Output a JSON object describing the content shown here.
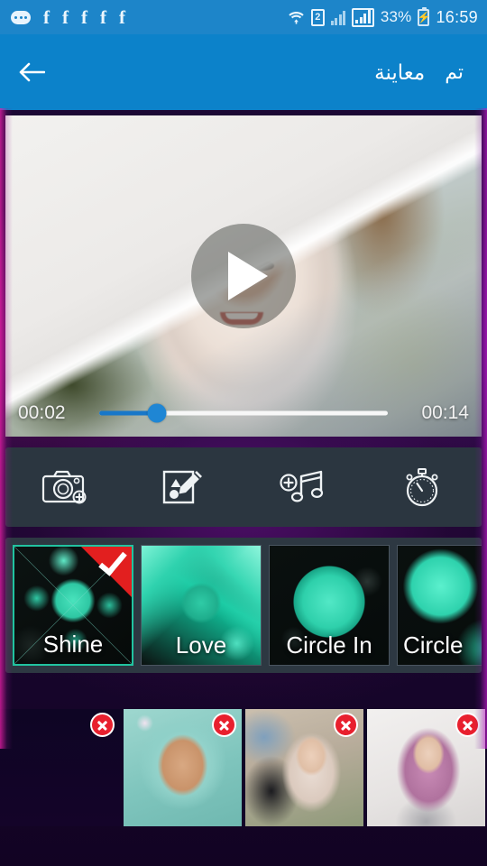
{
  "status_bar": {
    "notification_icons": [
      "more-dots-icon",
      "facebook-icon",
      "facebook-icon",
      "facebook-icon",
      "facebook-icon",
      "facebook-icon"
    ],
    "wifi_icon": "wifi-icon",
    "sim_label": "2",
    "signal_icon": "signal-bars-icon",
    "signal_boxed_icon": "signal-bars-boxed-icon",
    "battery_percent": "33%",
    "battery_icon": "battery-charging-icon",
    "clock": "16:59",
    "background_color": "#1d85c9"
  },
  "appbar": {
    "back_icon": "back-arrow-icon",
    "title": "معاينة",
    "done_label": "تم",
    "background_color": "#0c82ca"
  },
  "preview": {
    "play_icon": "play-icon",
    "current_time": "00:02",
    "total_time": "00:14",
    "progress_percent": 20,
    "seek_fill_color": "#1877c9"
  },
  "toolbar": {
    "background_color": "#2b3640",
    "items": [
      {
        "name": "add-photo-icon",
        "label": "Add Photo"
      },
      {
        "name": "edit-sticker-icon",
        "label": "Edit"
      },
      {
        "name": "add-music-icon",
        "label": "Add Music"
      },
      {
        "name": "duration-timer-icon",
        "label": "Duration"
      }
    ]
  },
  "effects": {
    "background_color": "#2d3842",
    "selected_index": 0,
    "selected_border_color": "#21c3a0",
    "check_badge_color": "#e21f1f",
    "items": [
      {
        "label": "Shine",
        "selected": true
      },
      {
        "label": "Love",
        "selected": false
      },
      {
        "label": "Circle In",
        "selected": false
      },
      {
        "label": "Circle",
        "selected": false
      }
    ]
  },
  "filmstrip": {
    "delete_icon": "delete-x-icon",
    "delete_button_color": "#e8202e",
    "items": [
      {
        "name": "photo-thumbnail-1"
      },
      {
        "name": "photo-thumbnail-2"
      },
      {
        "name": "photo-thumbnail-3"
      },
      {
        "name": "photo-thumbnail-4"
      }
    ]
  }
}
